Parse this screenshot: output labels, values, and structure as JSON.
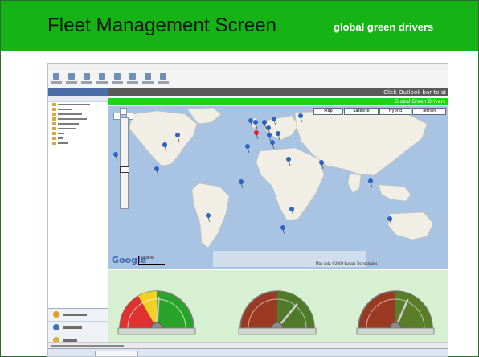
{
  "slide": {
    "title": "Fleet Management Screen",
    "subtitle": "global green drivers",
    "colors": {
      "title_bar": "#16b316",
      "gauge_panel": "#d7f0d1",
      "header_green": "#16d916"
    }
  },
  "app": {
    "content_header": "Click Outlook bar to st",
    "green_header": "Global Green Drivers",
    "map": {
      "types": [
        "Map",
        "Satellite",
        "Hybrid",
        "Terrain"
      ],
      "active_type": "Map",
      "credit": "Map data ©2009 Europa Technologies",
      "scale": "2000 mi",
      "logo": "Google"
    },
    "gauges": [
      {
        "needle_fraction": 0.52
      },
      {
        "needle_fraction": 0.72
      },
      {
        "needle_fraction": 0.63
      }
    ]
  }
}
